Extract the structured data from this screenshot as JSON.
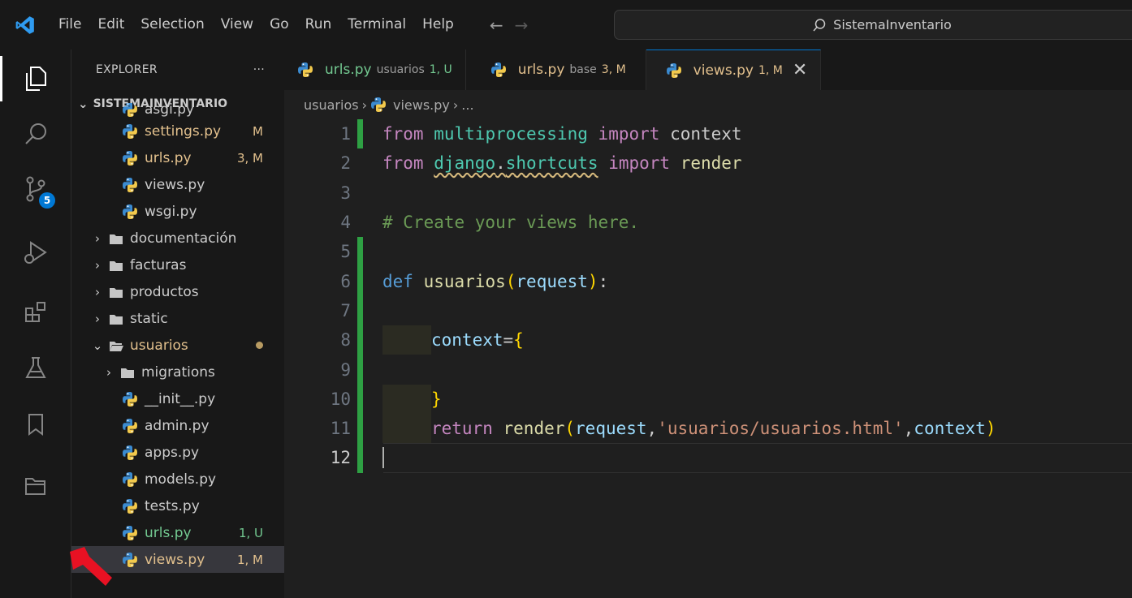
{
  "menu": [
    "File",
    "Edit",
    "Selection",
    "View",
    "Go",
    "Run",
    "Terminal",
    "Help"
  ],
  "search": {
    "text": "SistemaInventario",
    "icon": "search-icon"
  },
  "activity_bar": {
    "icons": [
      "explorer-icon",
      "search-icon",
      "source-control-icon",
      "run-debug-icon",
      "extensions-icon",
      "testing-icon",
      "bookmarks-icon",
      "folder-icon"
    ],
    "source_control_badge": "5"
  },
  "explorer": {
    "title": "EXPLORER",
    "more": "···",
    "section": "SISTEMAINVENTARIO",
    "items": [
      {
        "label": "asgi.py",
        "type": "file",
        "status": ""
      },
      {
        "label": "settings.py",
        "type": "file",
        "status": "M"
      },
      {
        "label": "urls.py",
        "type": "file",
        "status": "3, M"
      },
      {
        "label": "views.py",
        "type": "file",
        "status": ""
      },
      {
        "label": "wsgi.py",
        "type": "file",
        "status": ""
      },
      {
        "label": "documentación",
        "type": "folder",
        "status": ""
      },
      {
        "label": "facturas",
        "type": "folder",
        "status": ""
      },
      {
        "label": "productos",
        "type": "folder",
        "status": ""
      },
      {
        "label": "static",
        "type": "folder",
        "status": ""
      },
      {
        "label": "usuarios",
        "type": "folder-open",
        "status": ""
      },
      {
        "label": "migrations",
        "type": "folder",
        "status": ""
      },
      {
        "label": "__init__.py",
        "type": "file",
        "status": ""
      },
      {
        "label": "admin.py",
        "type": "file",
        "status": ""
      },
      {
        "label": "apps.py",
        "type": "file",
        "status": ""
      },
      {
        "label": "models.py",
        "type": "file",
        "status": ""
      },
      {
        "label": "tests.py",
        "type": "file",
        "status": ""
      },
      {
        "label": "urls.py",
        "type": "file",
        "status": "1, U"
      },
      {
        "label": "views.py",
        "type": "file",
        "status": "1, M"
      }
    ]
  },
  "tabs": [
    {
      "name": "urls.py",
      "desc": "usuarios",
      "status": "1, U"
    },
    {
      "name": "urls.py",
      "desc": "base",
      "status": "3, M"
    },
    {
      "name": "views.py",
      "desc": "",
      "status": "1, M",
      "close": "✕"
    }
  ],
  "breadcrumb": {
    "folder": "usuarios",
    "file": "views.py",
    "more": "..."
  },
  "code": {
    "line_numbers": [
      "1",
      "2",
      "3",
      "4",
      "5",
      "6",
      "7",
      "8",
      "9",
      "10",
      "11",
      "12"
    ],
    "l1": {
      "from": "from",
      "module": "multiprocessing",
      "import": "import",
      "name": "context"
    },
    "l2": {
      "from": "from",
      "module1": "django",
      "dot": ".",
      "module2": "shortcuts",
      "import": "import",
      "name": "render"
    },
    "l4": {
      "comment": "# Create your views here."
    },
    "l6": {
      "def": "def",
      "fname": "usuarios",
      "open": "(",
      "param": "request",
      "close": ")",
      "colon": ":"
    },
    "l8": {
      "var": "context",
      "eq": "=",
      "brace": "{"
    },
    "l10": {
      "brace": "}"
    },
    "l11": {
      "ret": "return",
      "fn": "render",
      "open": "(",
      "a1": "request",
      "comma1": ",",
      "str": "'usuarios/usuarios.html'",
      "comma2": ",",
      "a2": "context",
      "close": ")"
    }
  },
  "colors": {
    "accent": "#0078d4",
    "modified": "#e2c08d",
    "untracked": "#73c991",
    "arrow": "#e81123"
  }
}
